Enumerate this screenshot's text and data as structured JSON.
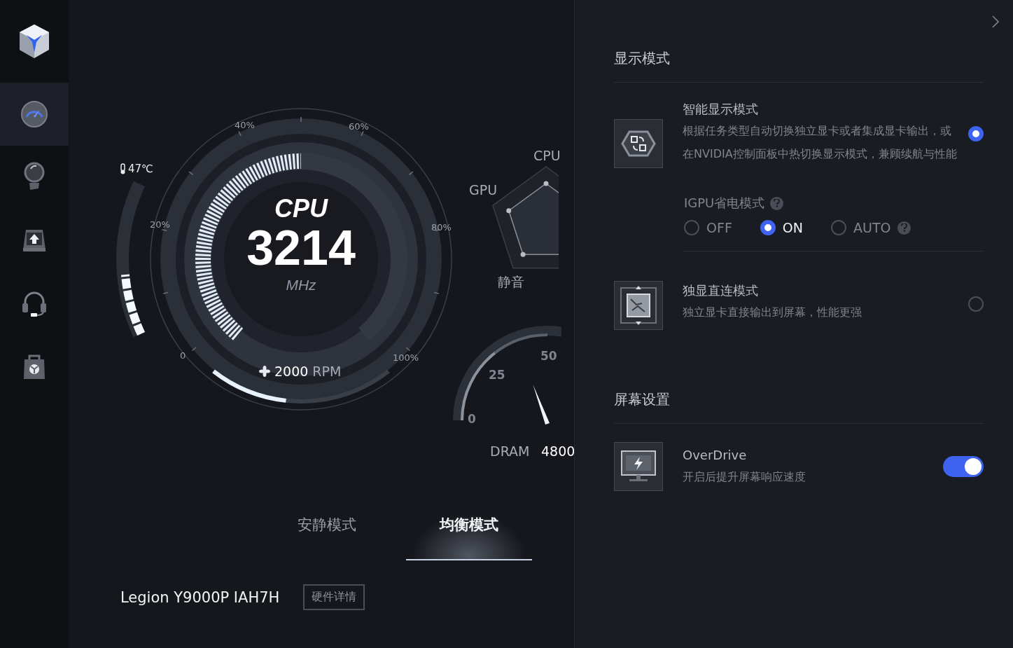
{
  "sidebar": {
    "items": [
      {
        "kind": "gauge",
        "selected": true
      },
      {
        "kind": "bulb",
        "selected": false
      },
      {
        "kind": "upload",
        "selected": false
      },
      {
        "kind": "headset",
        "selected": false
      },
      {
        "kind": "bag",
        "selected": false
      }
    ]
  },
  "cpu_gauge": {
    "title": "CPU",
    "value": "3214",
    "unit": "MHz",
    "ticks": [
      "0",
      "20%",
      "40%",
      "60%",
      "80%",
      "100%"
    ],
    "level": 0.5,
    "temperature": {
      "reading": "47℃",
      "level": 0.4
    },
    "fan": {
      "speed": "2000",
      "unit": "RPM",
      "level": 0.42
    }
  },
  "radar": {
    "labels": [
      "CPU",
      "GPU",
      "静音"
    ]
  },
  "dram_gauge": {
    "ticks": [
      "0",
      "25",
      "50"
    ],
    "label": "DRAM",
    "value": "4800"
  },
  "modes": [
    {
      "label": "安静模式",
      "selected": false
    },
    {
      "label": "均衡模式",
      "selected": true
    }
  ],
  "device": {
    "model": "Legion Y9000P IAH7H",
    "details_button": "硬件详情"
  },
  "display_section": {
    "title": "显示模式",
    "options": [
      {
        "kind": "smart",
        "title": "智能显示模式",
        "description": "根据任务类型自动切换独立显卡或者集成显卡输出，或在NVIDIA控制面板中热切换显示模式，兼顾续航与性能",
        "selected": true
      },
      {
        "kind": "chip",
        "title": "独显直连模式",
        "description": "独立显卡直接输出到屏幕，性能更强",
        "selected": false
      }
    ],
    "igpu": {
      "label": "IGPU省电模式",
      "options": [
        {
          "label": "OFF",
          "selected": false,
          "help": false
        },
        {
          "label": "ON",
          "selected": true,
          "help": false
        },
        {
          "label": "AUTO",
          "selected": false,
          "help": true
        }
      ]
    }
  },
  "screen_section": {
    "title": "屏幕设置",
    "overdrive": {
      "title": "OverDrive",
      "description": "开启后提升屏幕响应速度",
      "on": true
    }
  }
}
